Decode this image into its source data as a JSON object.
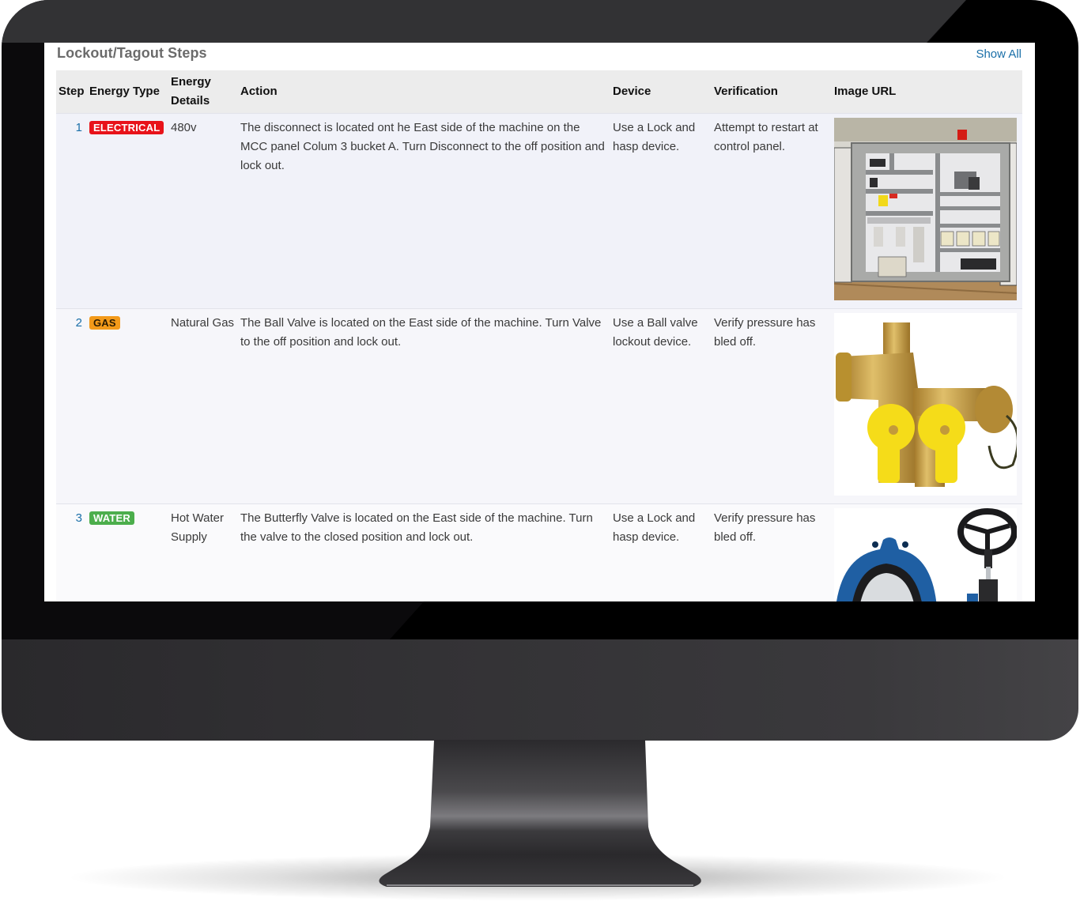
{
  "panel": {
    "title": "Lockout/Tagout Steps",
    "show_all_label": "Show All"
  },
  "table": {
    "headers": {
      "step": "Step",
      "energy_type": "Energy Type",
      "energy_details": "Energy Details",
      "action": "Action",
      "device": "Device",
      "verification": "Verification",
      "image_url": "Image URL"
    },
    "rows": [
      {
        "step": "1",
        "energy_type": "ELECTRICAL",
        "energy_type_color": "#e8131a",
        "energy_details": "480v",
        "action": "The disconnect is located ont he East side of the machine on the MCC panel Colum 3 bucket A. Turn Disconnect to the off position and lock out.",
        "device": "Use a Lock and hasp device.",
        "verification": "Attempt to restart at control panel.",
        "image": "electrical-control-panel-photo"
      },
      {
        "step": "2",
        "energy_type": "GAS",
        "energy_type_color": "#f39a1a",
        "energy_details": "Natural Gas",
        "action": "The Ball Valve is located on the East side of the machine. Turn Valve to the off position and lock out.",
        "device": "Use a Ball valve lockout device.",
        "verification": "Verify pressure has bled off.",
        "image": "brass-ball-valve-photo"
      },
      {
        "step": "3",
        "energy_type": "WATER",
        "energy_type_color": "#4cae4c",
        "energy_details": "Hot Water Supply",
        "action": "The Butterfly Valve is located on the East side of the machine. Turn the valve to the closed position and lock out.",
        "device": "Use a Lock and hasp device.",
        "verification": "Verify pressure has bled off.",
        "image": "butterfly-valve-photo"
      }
    ]
  },
  "colors": {
    "link": "#1a6fa8",
    "header_bg": "#ececec",
    "title_text": "#6b6b6b"
  }
}
